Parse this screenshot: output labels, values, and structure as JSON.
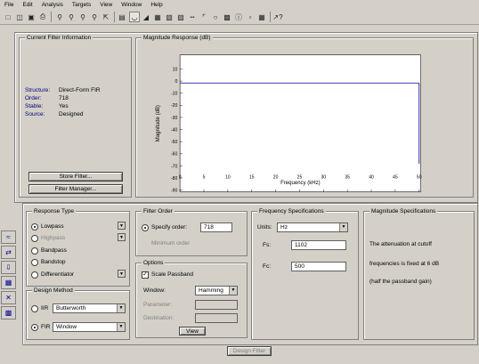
{
  "menu": [
    "File",
    "Edit",
    "Analysis",
    "Targets",
    "View",
    "Window",
    "Help"
  ],
  "toolbar_icons": [
    "new-icon",
    "open-icon",
    "save-icon",
    "print-icon",
    "zoom-in-icon",
    "zoom-out-icon",
    "full-view-icon",
    "filter-icon",
    "magnitude-icon",
    "phase-icon",
    "mag-phase-icon",
    "group-delay-icon",
    "phase-delay-icon",
    "impulse-icon",
    "step-icon",
    "pole-zero-icon",
    "coefficients-icon",
    "filter-info-icon",
    "legend-icon",
    "grid-icon",
    "whats-this-icon"
  ],
  "current_filter": {
    "title": "Current Filter Information",
    "rows": [
      {
        "key": "Structure:",
        "value": "Direct-Form FIR"
      },
      {
        "key": "Order:",
        "value": "718"
      },
      {
        "key": "Stable:",
        "value": "Yes"
      },
      {
        "key": "Source:",
        "value": "Designed"
      }
    ],
    "store_button": "Store Filter...",
    "manager_button": "Filter Manager..."
  },
  "plot": {
    "title": "Magnitude Response (dB)",
    "ylabel": "Magnitude (dB)",
    "xlabel": "Frequency (kHz)",
    "yticks": [
      "10",
      "0",
      "-10",
      "-20",
      "-30",
      "-40",
      "-50",
      "-60",
      "-70",
      "-80",
      "-90"
    ],
    "xticks": [
      "0",
      "5",
      "10",
      "15",
      "20",
      "25",
      "30",
      "35",
      "40",
      "45",
      "50"
    ]
  },
  "response_type": {
    "title": "Response Type",
    "items": [
      {
        "label": "Lowpass",
        "combo": true,
        "selected": true
      },
      {
        "label": "Highpass",
        "combo": true,
        "selected": false
      },
      {
        "label": "Bandpass",
        "combo": false,
        "selected": false
      },
      {
        "label": "Bandstop",
        "combo": false,
        "selected": false
      },
      {
        "label": "Differentiator",
        "combo": true,
        "selected": false
      }
    ]
  },
  "design_method": {
    "title": "Design Method",
    "iir_label": "IIR",
    "iir_value": "Butterworth",
    "fir_label": "FIR",
    "fir_value": "Window",
    "selected": "FIR"
  },
  "filter_order": {
    "title": "Filter Order",
    "specify_label": "Specify order:",
    "specify_value": "718",
    "minimum_label": "Minimum order"
  },
  "options": {
    "title": "Options",
    "scale_label": "Scale Passband",
    "scale_checked": true,
    "window_label": "Window:",
    "window_value": "Hamming",
    "param_label": "Parameter:",
    "param2_label": "Destination:",
    "view_button": "View"
  },
  "freq_spec": {
    "title": "Frequency Specifications",
    "units_label": "Units:",
    "units_value": "Hz",
    "fs_label": "Fs:",
    "fs_value": "1102",
    "fc_label": "Fc:",
    "fc_value": "500"
  },
  "mag_spec": {
    "title": "Magnitude Specifications",
    "lines": [
      "The attenuation at cutoff",
      "frequencies is fixed at 6 dB",
      "(half the passband gain)"
    ]
  },
  "design_button": "Design Filter",
  "sidebar_icons": [
    "design-filter-icon",
    "transform-icon",
    "import-icon",
    "quantize-icon",
    "pole-zero-editor-icon",
    "realize-model-icon"
  ],
  "colors": {
    "response_line": "#0000a0",
    "plot_bg": "#ffffff",
    "window_bg": "#d4d0c8"
  }
}
